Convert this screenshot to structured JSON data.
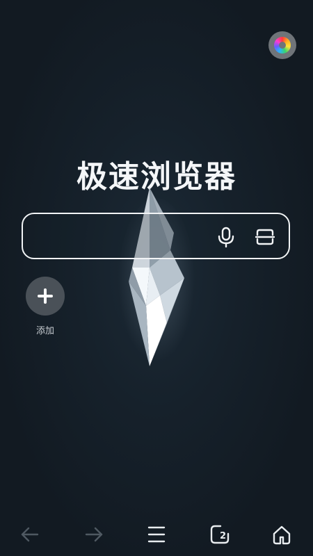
{
  "header": {
    "avatar_icon": "color-ring-icon"
  },
  "main": {
    "title": "极速浏览器",
    "search": {
      "placeholder": "",
      "value": "",
      "mic_icon": "microphone-icon",
      "scan_icon": "scan-icon"
    },
    "shortcuts": [
      {
        "label": "添加",
        "icon": "plus-icon"
      }
    ]
  },
  "bottom_nav": {
    "back_icon": "arrow-left-icon",
    "forward_icon": "arrow-right-icon",
    "menu_icon": "menu-icon",
    "tabs_icon": "tabs-icon",
    "tabs_count": "2",
    "home_icon": "home-icon"
  },
  "colors": {
    "background": "#141c24",
    "accent": "#f2f4f6",
    "add_button": "#4a5158"
  }
}
